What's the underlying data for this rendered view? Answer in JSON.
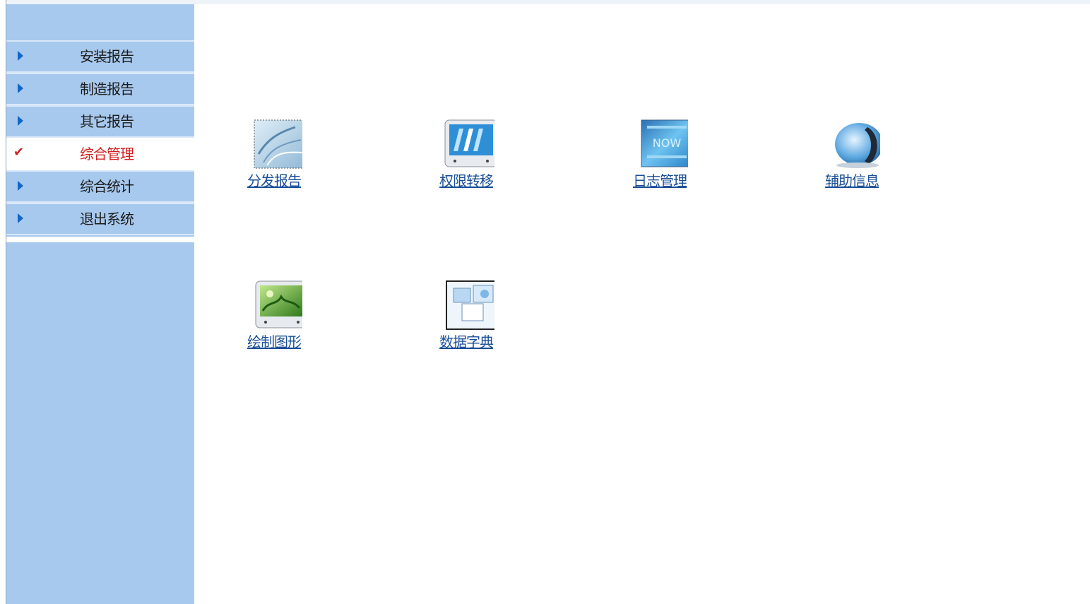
{
  "sidebar": {
    "items": [
      {
        "label": "安装报告",
        "icon": "arrow-right-icon",
        "active": false
      },
      {
        "label": "制造报告",
        "icon": "arrow-right-icon",
        "active": false
      },
      {
        "label": "其它报告",
        "icon": "arrow-right-icon",
        "active": false
      },
      {
        "label": "综合管理",
        "icon": "checkmark-icon",
        "active": true
      },
      {
        "label": "综合统计",
        "icon": "arrow-right-icon",
        "active": false
      },
      {
        "label": "退出系统",
        "icon": "arrow-right-icon",
        "active": false
      }
    ]
  },
  "main": {
    "tiles": [
      {
        "label": "分发报告",
        "icon": "distribute-report-icon"
      },
      {
        "label": "权限转移",
        "icon": "permission-transfer-icon"
      },
      {
        "label": "日志管理",
        "icon": "log-management-icon"
      },
      {
        "label": "辅助信息",
        "icon": "auxiliary-info-icon"
      },
      {
        "label": "绘制图形",
        "icon": "draw-graphics-icon"
      },
      {
        "label": "数据字典",
        "icon": "data-dictionary-icon"
      }
    ]
  },
  "colors": {
    "sidebar_bg": "#a8c9ee",
    "active_text": "#d21f1f",
    "arrow": "#1366c7",
    "link": "#1a4f98"
  }
}
